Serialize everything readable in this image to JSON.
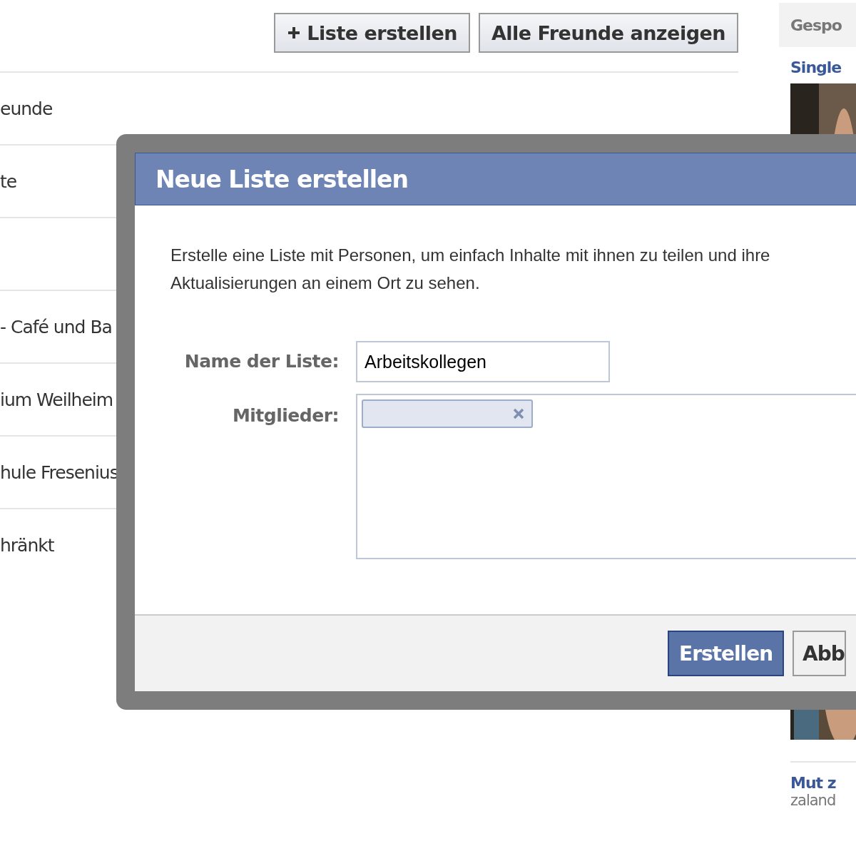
{
  "toolbar": {
    "buttons": [
      {
        "kind": "add",
        "label": "Liste erstellen"
      },
      {
        "kind": "plain",
        "label": "Alle Freunde anzeigen"
      }
    ]
  },
  "lists": [
    {
      "kind": "text",
      "label": "eunde"
    },
    {
      "kind": "text",
      "label": "te"
    },
    {
      "kind": "blank"
    },
    {
      "kind": "text",
      "label": "- Café und Ba"
    },
    {
      "kind": "text",
      "label": "ium Weilheim"
    },
    {
      "kind": "text",
      "label": "hule Fresenius"
    },
    {
      "kind": "text",
      "label": "hränkt"
    }
  ],
  "sidebar": {
    "header": "Gespo",
    "ads": [
      {
        "title": "Single",
        "kind": "picture"
      },
      {
        "title": "Mut z",
        "source": "zaland"
      }
    ]
  },
  "dialog": {
    "title": "Neue Liste erstellen",
    "description": "Erstelle eine Liste mit Personen, um einfach Inhalte mit ihnen zu teilen und ihre Aktualisierungen an einem Ort zu sehen.",
    "fields": [
      {
        "kind": "text",
        "label": "Name der Liste:",
        "value": "Arbeitskollegen"
      },
      {
        "kind": "tokens",
        "label": "Mitglieder:",
        "tokens": [
          {
            "removable": true
          }
        ]
      }
    ],
    "buttons": [
      {
        "label": "Erstellen",
        "primary": true
      },
      {
        "label": "Abb",
        "primary": false
      }
    ]
  }
}
